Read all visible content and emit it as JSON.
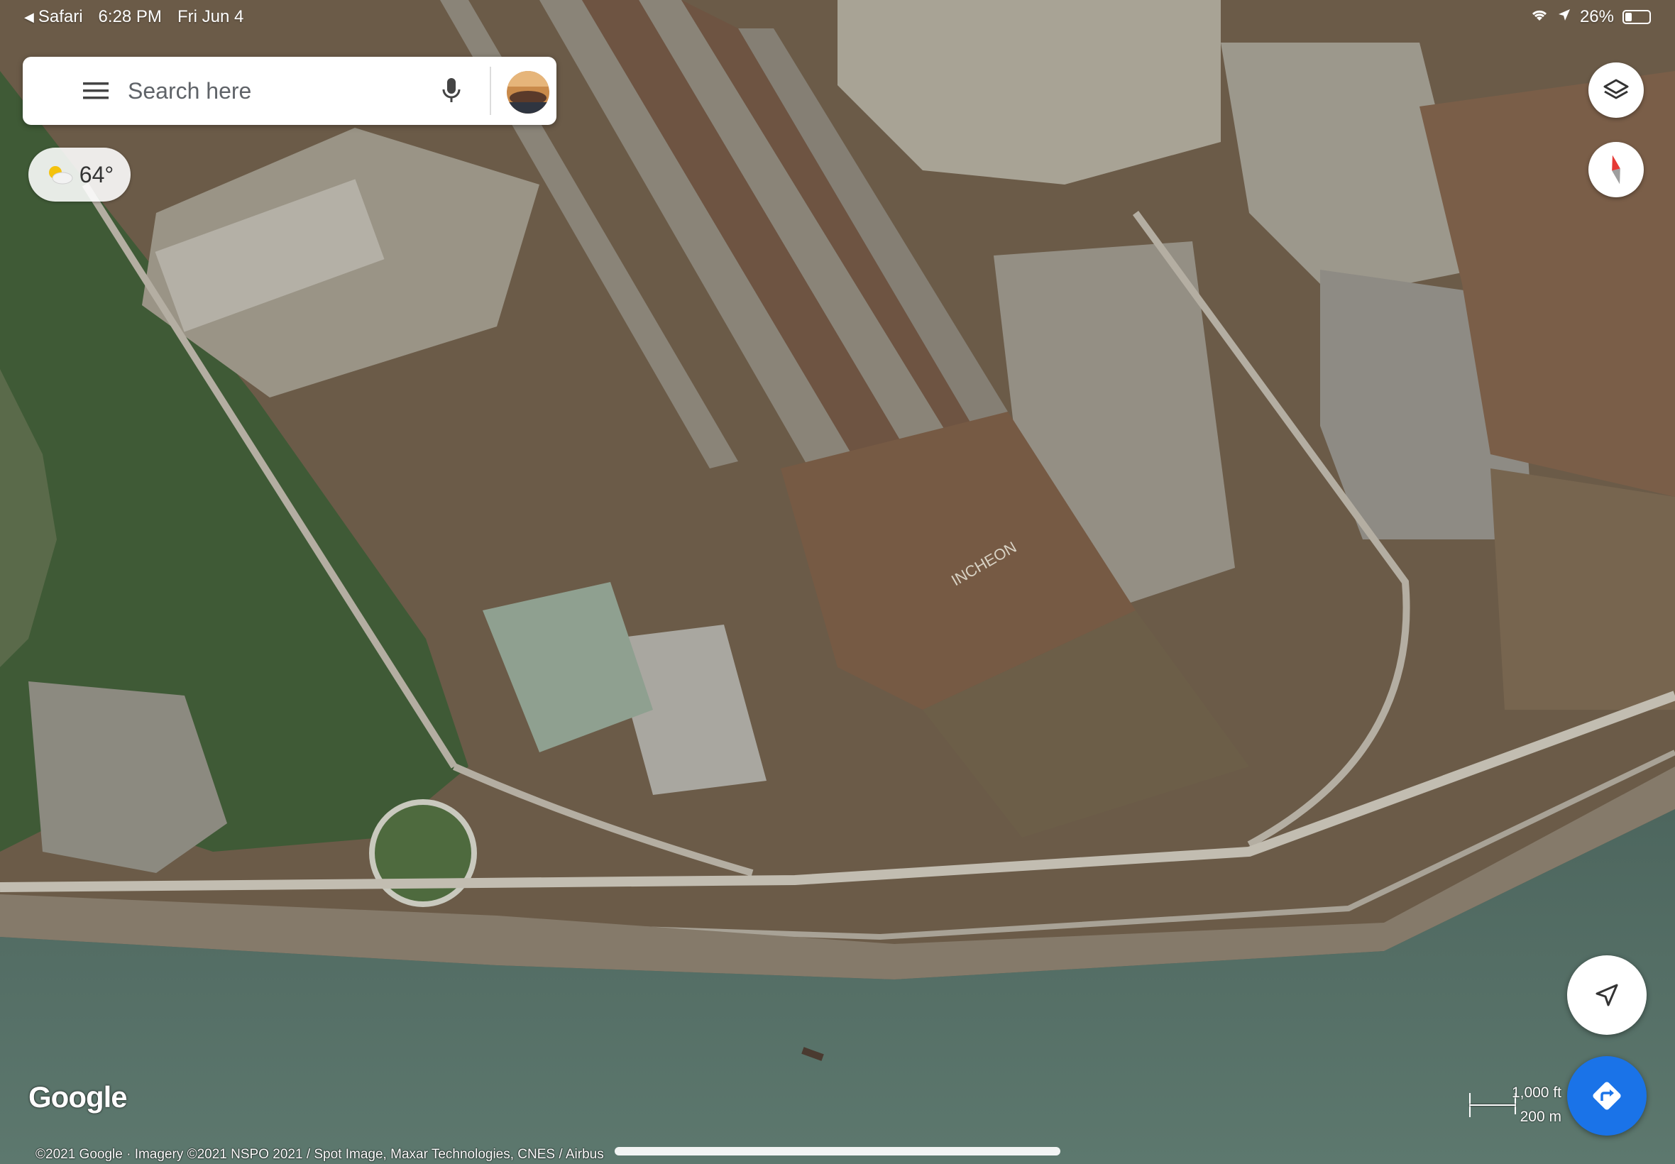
{
  "status_bar": {
    "back_app": "Safari",
    "time": "6:28 PM",
    "date": "Fri Jun 4",
    "battery": "26%",
    "battery_level": 0.26
  },
  "search": {
    "placeholder": "Search here"
  },
  "weather": {
    "temperature": "64°",
    "icon": "partly-sunny-icon"
  },
  "map": {
    "type": "satellite",
    "label_on_ground": "INCHEON",
    "logo": "Google",
    "scale": {
      "imperial": "1,000 ft",
      "metric": "200 m"
    },
    "attribution": "©2021 Google · Imagery ©2021 NSPO 2021 / Spot Image, Maxar Technologies, CNES / Airbus"
  },
  "controls": {
    "layers_icon": "layers-icon",
    "compass_icon": "compass-icon",
    "location_icon": "my-location-icon",
    "directions_icon": "directions-icon",
    "directions_color": "#1a73e8"
  }
}
